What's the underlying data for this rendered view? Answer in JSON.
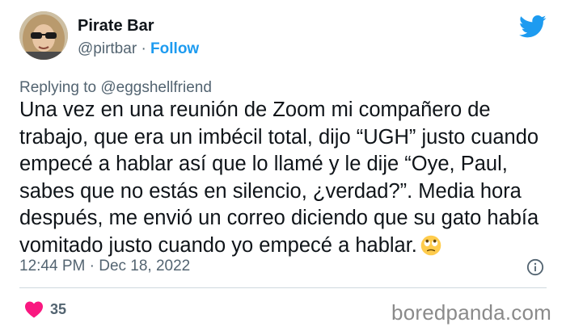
{
  "author": {
    "display_name": "Pirate Bar",
    "handle": "@pirtbar",
    "separator": "·",
    "follow_label": "Follow"
  },
  "reply": {
    "prefix": "Replying to ",
    "target": "@eggshellfriend"
  },
  "tweet": {
    "text": "Una vez en una reunión de Zoom mi compañero de trabajo, que era un imbécil total, dijo “UGH” justo cuando empecé a hablar así que lo llamé y le dije “Oye, Paul, sabes que no estás en silencio, ¿verdad?”. Media hora después, me envió un correo diciendo que su gato había vomitado justo cuando yo empecé a hablar.",
    "emoji": "eye-roll-emoji"
  },
  "meta": {
    "time": "12:44 PM",
    "separator": "·",
    "date": "Dec 18, 2022"
  },
  "engagement": {
    "likes": "35"
  },
  "watermark": "boredpanda.com",
  "colors": {
    "brand": "#1d9bf0",
    "like": "#f91880",
    "secondary_text": "#536471",
    "primary_text": "#0f1419"
  }
}
